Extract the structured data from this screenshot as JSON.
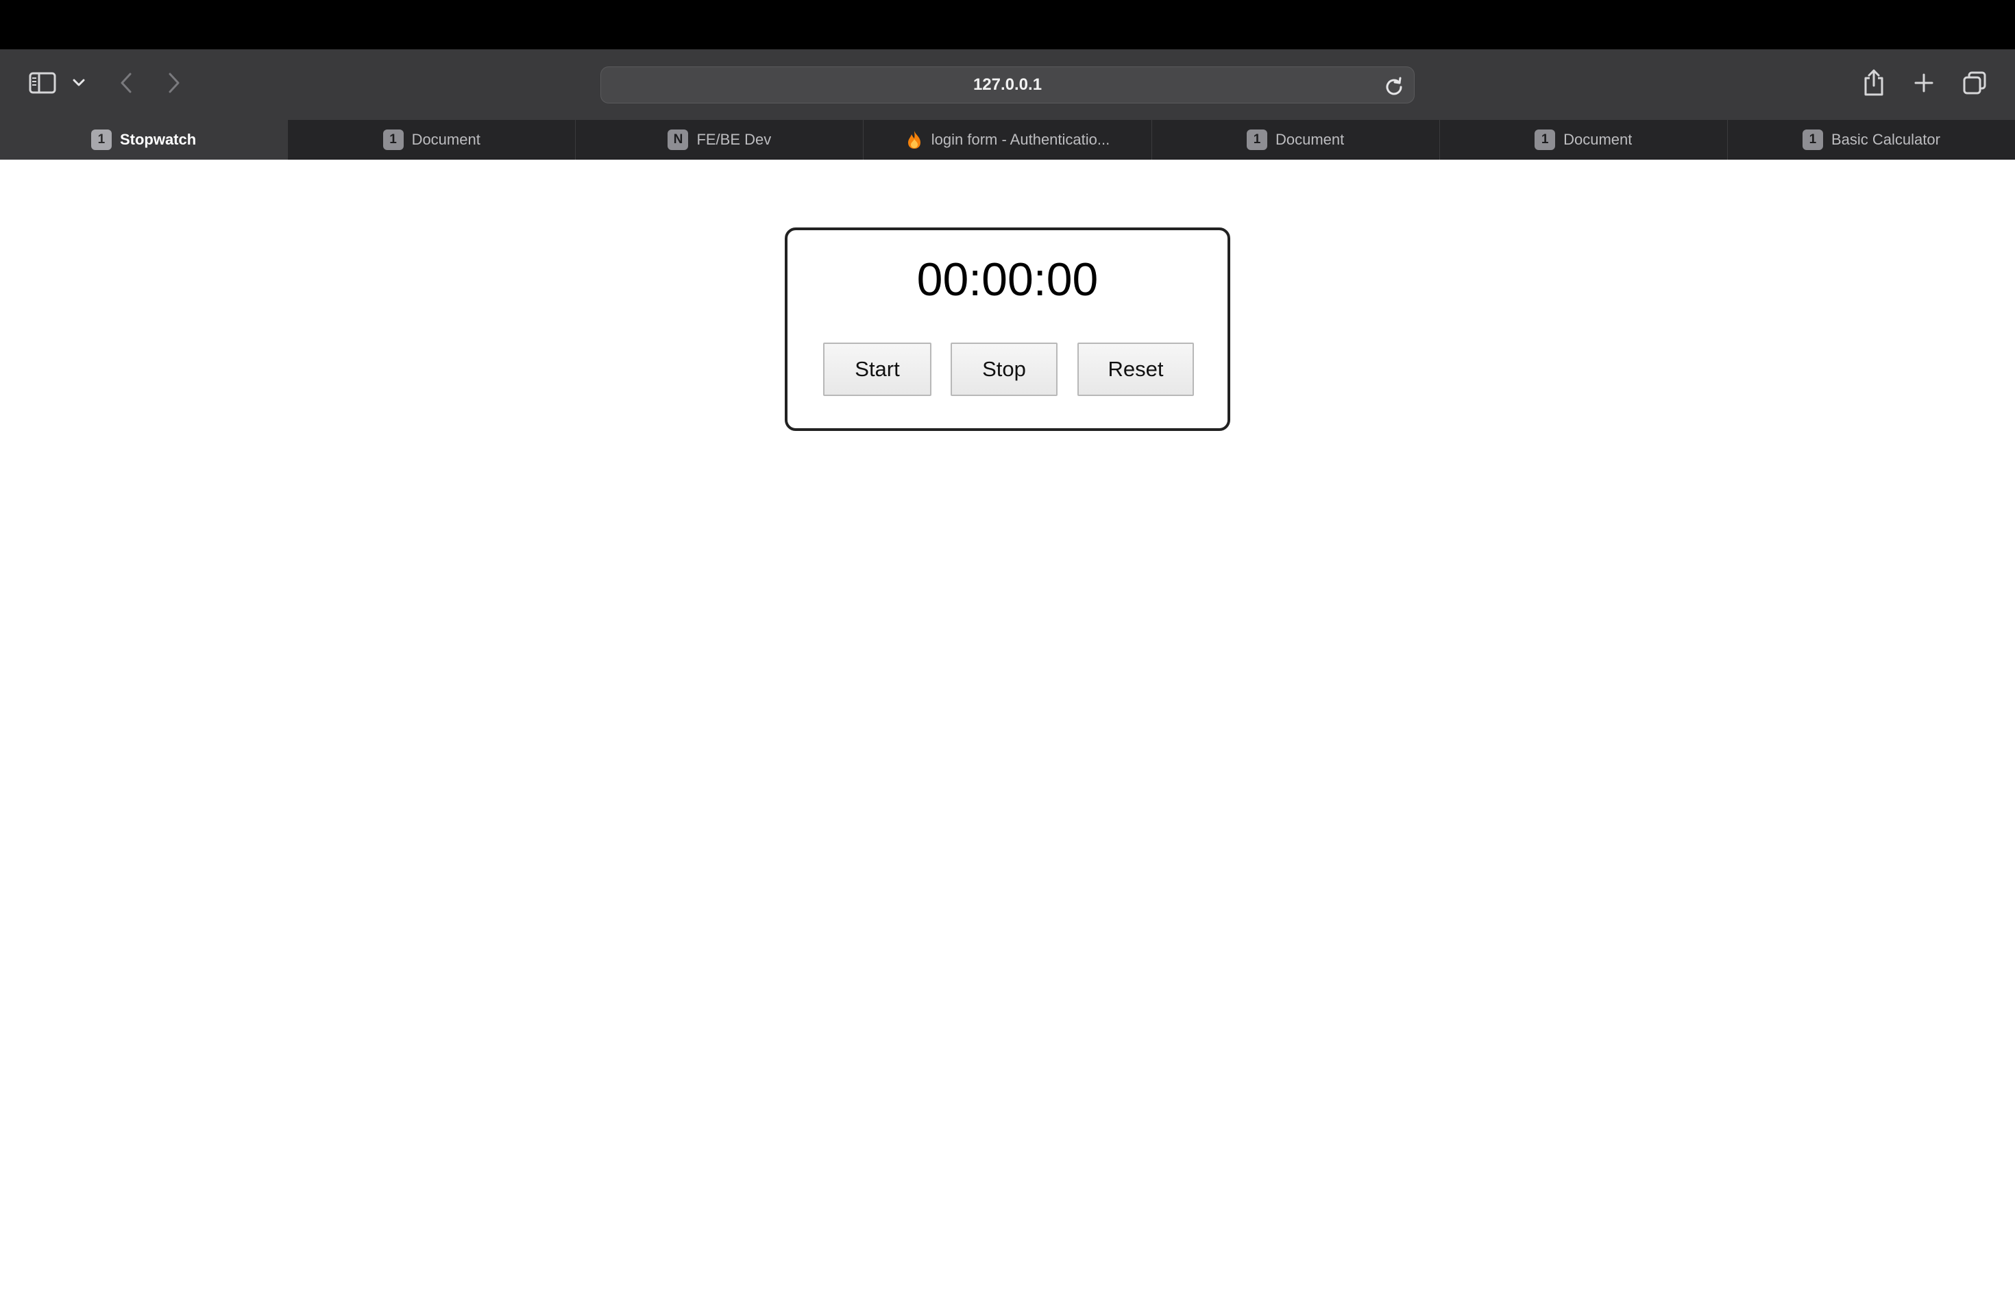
{
  "browser": {
    "address": "127.0.0.1",
    "tabs": [
      {
        "label": "Stopwatch",
        "badge": "1",
        "active": true
      },
      {
        "label": "Document",
        "badge": "1",
        "active": false
      },
      {
        "label": "FE/BE Dev",
        "badge": "N",
        "active": false
      },
      {
        "label": "login form - Authenticatio...",
        "badge": "",
        "icon": "flame-icon",
        "active": false
      },
      {
        "label": "Document",
        "badge": "1",
        "active": false
      },
      {
        "label": "Document",
        "badge": "1",
        "active": false
      },
      {
        "label": "Basic Calculator",
        "badge": "1",
        "active": false
      }
    ],
    "icons": [
      "sidebar-icon",
      "chevron-down-icon",
      "back-icon",
      "forward-icon",
      "reload-icon",
      "share-icon",
      "new-tab-icon",
      "tab-overview-icon"
    ]
  },
  "stopwatch": {
    "display": "00:00:00",
    "start_label": "Start",
    "stop_label": "Stop",
    "reset_label": "Reset"
  },
  "colors": {
    "toolbar": "#3a3a3c",
    "tabbar": "#252527",
    "active_tab": "#3a3a3c",
    "page_bg": "#ffffff",
    "card_border": "#222222"
  }
}
